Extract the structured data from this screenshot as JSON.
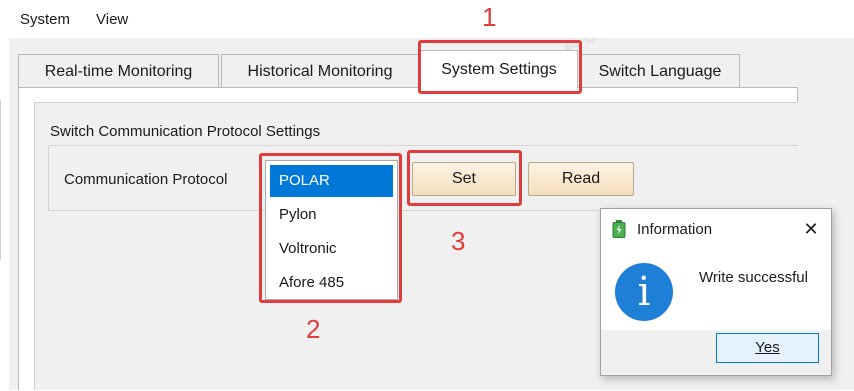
{
  "menubar": {
    "items": [
      "System",
      "View"
    ]
  },
  "tabs": [
    {
      "label": "Real-time Monitoring"
    },
    {
      "label": "Historical Monitoring"
    },
    {
      "label": "System Settings"
    },
    {
      "label": "Switch Language"
    }
  ],
  "settings": {
    "group_title": "Switch Communication Protocol Settings",
    "field_label": "Communication Protocol",
    "protocol_options": [
      "POLAR",
      "Pylon",
      "Voltronic",
      "Afore 485"
    ],
    "selected_option": "POLAR",
    "set_button": "Set",
    "read_button": "Read"
  },
  "annotations": {
    "step1": "1",
    "step2": "2",
    "step3": "3"
  },
  "dialog": {
    "title": "Information",
    "close_glyph": "✕",
    "message": "Write successful",
    "info_glyph": "i",
    "yes_button": "Yes"
  },
  "colors": {
    "accent_red": "#e03c3c",
    "selection_blue": "#0078d7",
    "info_blue": "#1d7fd6"
  }
}
